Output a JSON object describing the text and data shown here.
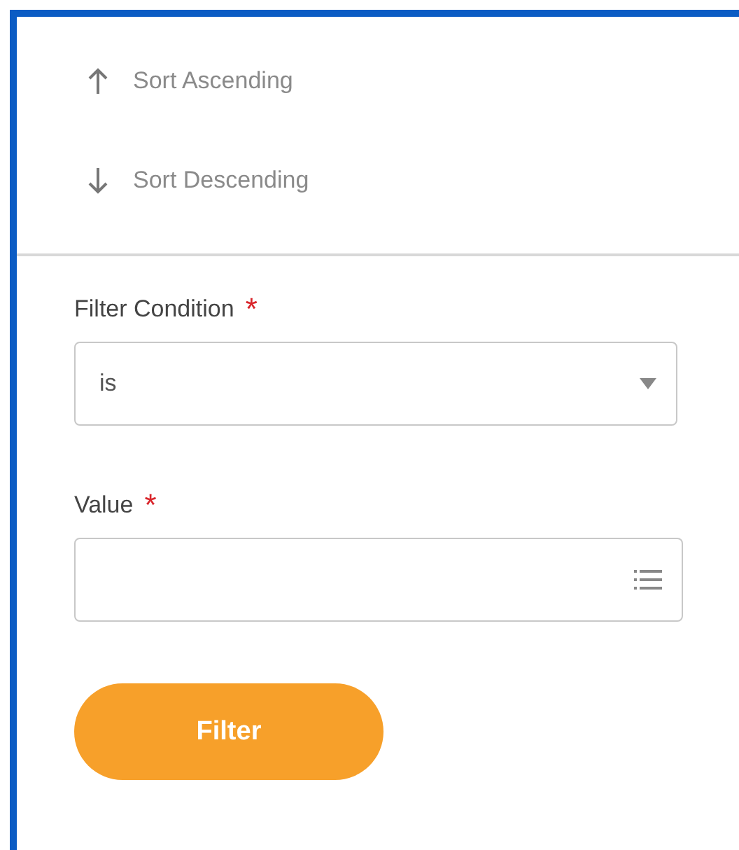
{
  "sort_options": [
    {
      "kind": "ascending",
      "label": "Sort Ascending"
    },
    {
      "kind": "descending",
      "label": "Sort Descending"
    }
  ],
  "fields": [
    {
      "kind": "dropdown",
      "label": "Filter Condition",
      "required_mark": "*",
      "value": "is"
    },
    {
      "kind": "prompt",
      "label": "Value",
      "required_mark": "*"
    }
  ],
  "button": {
    "label": "Filter"
  }
}
